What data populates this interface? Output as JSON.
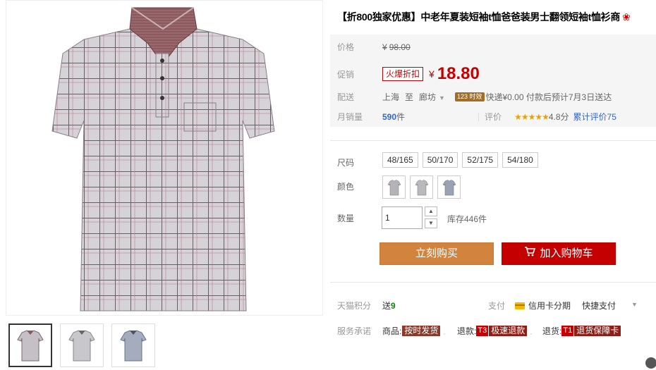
{
  "product": {
    "title": "【折800独家优惠】中老年夏装短袖t恤爸爸装男士翻领短袖t恤衫商",
    "title_icon": "flower-icon"
  },
  "price": {
    "label": "价格",
    "currency": "¥",
    "original": "98.00",
    "promo_label": "促销",
    "promo_tag": "火爆折扣",
    "promo_price": "18.80"
  },
  "shipping": {
    "label": "配送",
    "from": "上海",
    "to_word": "至",
    "to": "廊坊",
    "badge": "123 时效",
    "info": "快递¥0.00 付款后预计7月3日送达"
  },
  "sales": {
    "label": "月销量",
    "count": "590",
    "unit": "件",
    "rating_label": "评价",
    "stars": "★★★★★",
    "rating": 4.8,
    "rating_text": "4.8分",
    "review_text": "累计评价75"
  },
  "sku": {
    "size_label": "尺码",
    "sizes": [
      "48/165",
      "50/170",
      "52/175",
      "54/180"
    ],
    "color_label": "颜色",
    "colors": [
      "#b5b3b8",
      "#b9b8bc",
      "#9aa3b4"
    ],
    "qty_label": "数量",
    "qty_value": "1",
    "stock": "库存446件"
  },
  "actions": {
    "buy": "立刻购买",
    "cart": "加入购物车"
  },
  "extras": {
    "points_label": "天猫积分",
    "points_prefix": "送",
    "points_value": "9",
    "pay_label": "支付",
    "credit": "信用卡分期",
    "quick_pay": "快捷支付",
    "service_label": "服务承诺",
    "svc1_prefix": "商品:",
    "svc1_tag": "按时发货",
    "svc2_prefix": "退款:",
    "svc2_box": "T3",
    "svc2_tag": "极速退款",
    "svc3_prefix": "退货:",
    "svc3_box": "T1",
    "svc3_tag": "退货保障卡"
  },
  "colors": {
    "accent_red": "#c40000",
    "buy_orange": "#d2843e",
    "link_blue": "#3366cc",
    "price_bg": "#f5f5f5"
  }
}
